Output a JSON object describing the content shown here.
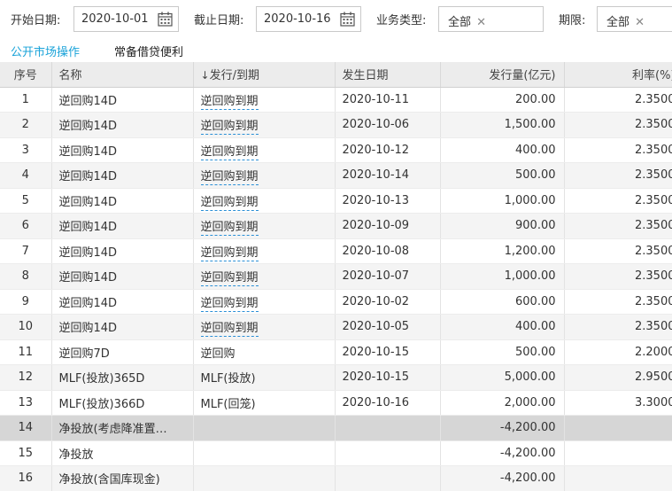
{
  "filters": {
    "start_label": "开始日期:",
    "start_value": "2020-10-01",
    "end_label": "截止日期:",
    "end_value": "2020-10-16",
    "type_label": "业务类型:",
    "type_tag": "全部",
    "term_label": "期限:",
    "term_tag": "全部",
    "tag_remove": "✕"
  },
  "tabs": [
    {
      "label": "公开市场操作",
      "active": true
    },
    {
      "label": "常备借贷便利",
      "active": false
    }
  ],
  "table": {
    "headers": {
      "no": "序号",
      "name": "名称",
      "type_arrow": "↓",
      "type": "发行/到期",
      "date": "发生日期",
      "amount": "发行量(亿元)",
      "rate": "利率(%)"
    },
    "rows": [
      {
        "no": "1",
        "name": "逆回购14D",
        "type": "逆回购到期",
        "link": true,
        "date": "2020-10-11",
        "amount": "200.00",
        "rate": "2.3500"
      },
      {
        "no": "2",
        "name": "逆回购14D",
        "type": "逆回购到期",
        "link": true,
        "date": "2020-10-06",
        "amount": "1,500.00",
        "rate": "2.3500"
      },
      {
        "no": "3",
        "name": "逆回购14D",
        "type": "逆回购到期",
        "link": true,
        "date": "2020-10-12",
        "amount": "400.00",
        "rate": "2.3500"
      },
      {
        "no": "4",
        "name": "逆回购14D",
        "type": "逆回购到期",
        "link": true,
        "date": "2020-10-14",
        "amount": "500.00",
        "rate": "2.3500"
      },
      {
        "no": "5",
        "name": "逆回购14D",
        "type": "逆回购到期",
        "link": true,
        "date": "2020-10-13",
        "amount": "1,000.00",
        "rate": "2.3500"
      },
      {
        "no": "6",
        "name": "逆回购14D",
        "type": "逆回购到期",
        "link": true,
        "date": "2020-10-09",
        "amount": "900.00",
        "rate": "2.3500"
      },
      {
        "no": "7",
        "name": "逆回购14D",
        "type": "逆回购到期",
        "link": true,
        "date": "2020-10-08",
        "amount": "1,200.00",
        "rate": "2.3500"
      },
      {
        "no": "8",
        "name": "逆回购14D",
        "type": "逆回购到期",
        "link": true,
        "date": "2020-10-07",
        "amount": "1,000.00",
        "rate": "2.3500"
      },
      {
        "no": "9",
        "name": "逆回购14D",
        "type": "逆回购到期",
        "link": true,
        "date": "2020-10-02",
        "amount": "600.00",
        "rate": "2.3500"
      },
      {
        "no": "10",
        "name": "逆回购14D",
        "type": "逆回购到期",
        "link": true,
        "date": "2020-10-05",
        "amount": "400.00",
        "rate": "2.3500"
      },
      {
        "no": "11",
        "name": "逆回购7D",
        "type": "逆回购",
        "link": false,
        "date": "2020-10-15",
        "amount": "500.00",
        "rate": "2.2000"
      },
      {
        "no": "12",
        "name": "MLF(投放)365D",
        "type": "MLF(投放)",
        "link": false,
        "date": "2020-10-15",
        "amount": "5,000.00",
        "rate": "2.9500"
      },
      {
        "no": "13",
        "name": "MLF(投放)366D",
        "type": "MLF(回笼)",
        "link": false,
        "date": "2020-10-16",
        "amount": "2,000.00",
        "rate": "3.3000"
      },
      {
        "no": "14",
        "name": "净投放(考虑降准置…",
        "type": "",
        "link": false,
        "date": "",
        "amount": "-4,200.00",
        "rate": "",
        "highlight": true
      },
      {
        "no": "15",
        "name": "净投放",
        "type": "",
        "link": false,
        "date": "",
        "amount": "-4,200.00",
        "rate": ""
      },
      {
        "no": "16",
        "name": "净投放(含国库现金)",
        "type": "",
        "link": false,
        "date": "",
        "amount": "-4,200.00",
        "rate": ""
      }
    ]
  },
  "colors": {
    "accent": "#1aa3d9",
    "header_bg": "#ececec",
    "row_alt_bg": "#f4f4f4",
    "highlight_bg": "#d6d6d6"
  },
  "icons": {
    "calendar": "calendar-icon",
    "remove": "close-icon",
    "sort": "sort-down-icon"
  }
}
